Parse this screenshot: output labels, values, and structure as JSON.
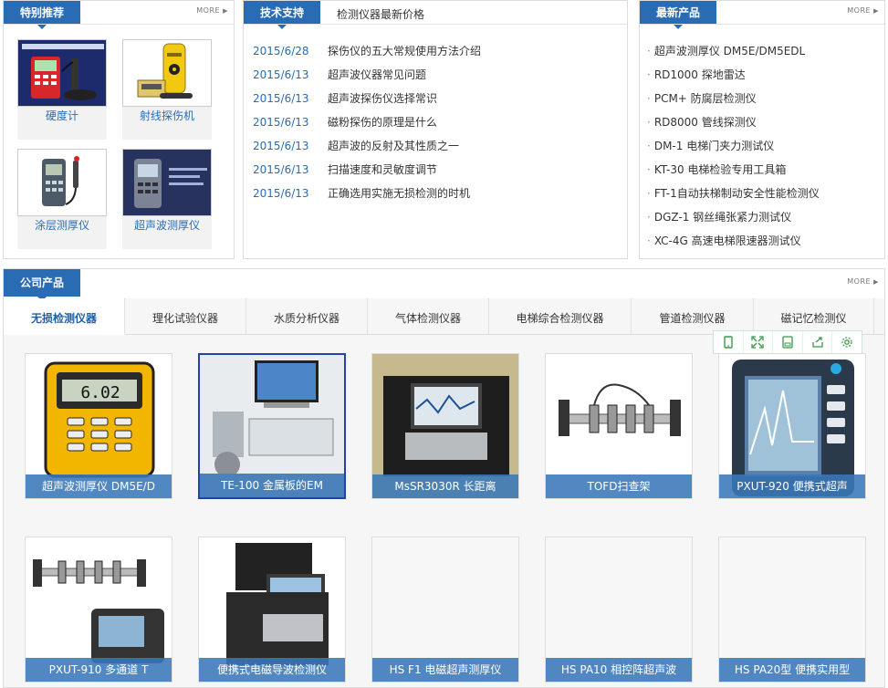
{
  "special": {
    "title": "特别推荐",
    "more": "MORE",
    "items": [
      {
        "label": "硬度计",
        "icon": "hardness-tester-image"
      },
      {
        "label": "射线探伤机",
        "icon": "xray-flaw-detector-image"
      },
      {
        "label": "涂层测厚仪",
        "icon": "coating-thickness-gauge-image"
      },
      {
        "label": "超声波测厚仪",
        "icon": "ultrasonic-thickness-gauge-image"
      }
    ]
  },
  "tech": {
    "title": "技术支持",
    "subtitle": "检测仪器最新价格",
    "items": [
      {
        "date": "2015/6/28",
        "title": "探伤仪的五大常规使用方法介绍"
      },
      {
        "date": "2015/6/13",
        "title": "超声波仪器常见问题"
      },
      {
        "date": "2015/6/13",
        "title": "超声波探伤仪选择常识"
      },
      {
        "date": "2015/6/13",
        "title": "磁粉探伤的原理是什么"
      },
      {
        "date": "2015/6/13",
        "title": "超声波的反射及其性质之一"
      },
      {
        "date": "2015/6/13",
        "title": "扫描速度和灵敏度调节"
      },
      {
        "date": "2015/6/13",
        "title": "正确选用实施无损检测的时机"
      }
    ]
  },
  "latest": {
    "title": "最新产品",
    "more": "MORE",
    "items": [
      "超声波测厚仪 DM5E/DM5EDL",
      "RD1000 探地雷达",
      "PCM+ 防腐层检测仪",
      "RD8000 管线探测仪",
      "DM-1 电梯门夹力测试仪",
      "KT-30 电梯检验专用工具箱",
      "FT-1自动扶梯制动安全性能检测仪",
      "DGZ-1 钢丝绳张紧力测试仪",
      "XC-4G 高速电梯限速器测试仪"
    ]
  },
  "company": {
    "title": "公司产品",
    "more": "MORE",
    "tabs": [
      {
        "label": "无损检测仪器",
        "active": true
      },
      {
        "label": "理化试验仪器",
        "active": false
      },
      {
        "label": "水质分析仪器",
        "active": false
      },
      {
        "label": "气体检测仪器",
        "active": false
      },
      {
        "label": "电梯综合检测仪器",
        "active": false
      },
      {
        "label": "管道检测仪器",
        "active": false
      },
      {
        "label": "磁记忆检测仪",
        "active": false
      }
    ],
    "products": [
      {
        "caption": "超声波测厚仪 DM5E/D"
      },
      {
        "caption": "TE-100 金属板的EM"
      },
      {
        "caption": "MsSR3030R 长距离"
      },
      {
        "caption": "TOFD扫查架"
      },
      {
        "caption": "PXUT-920 便携式超声"
      },
      {
        "caption": "PXUT-910 多通道 T"
      },
      {
        "caption": "便携式电磁导波检测仪"
      },
      {
        "caption": "HS F1 电磁超声测厚仪"
      },
      {
        "caption": "HS PA10 相控阵超声波"
      },
      {
        "caption": "HS PA20型 便携实用型"
      }
    ]
  },
  "toolbar": {
    "icons": [
      "mobile-icon",
      "fullscreen-icon",
      "save-icon",
      "share-icon",
      "settings-icon"
    ]
  },
  "colors": {
    "accent": "#2a6cb3",
    "caption_bg": "#3a78b8",
    "toolbar_icon": "#3a9a4a"
  }
}
